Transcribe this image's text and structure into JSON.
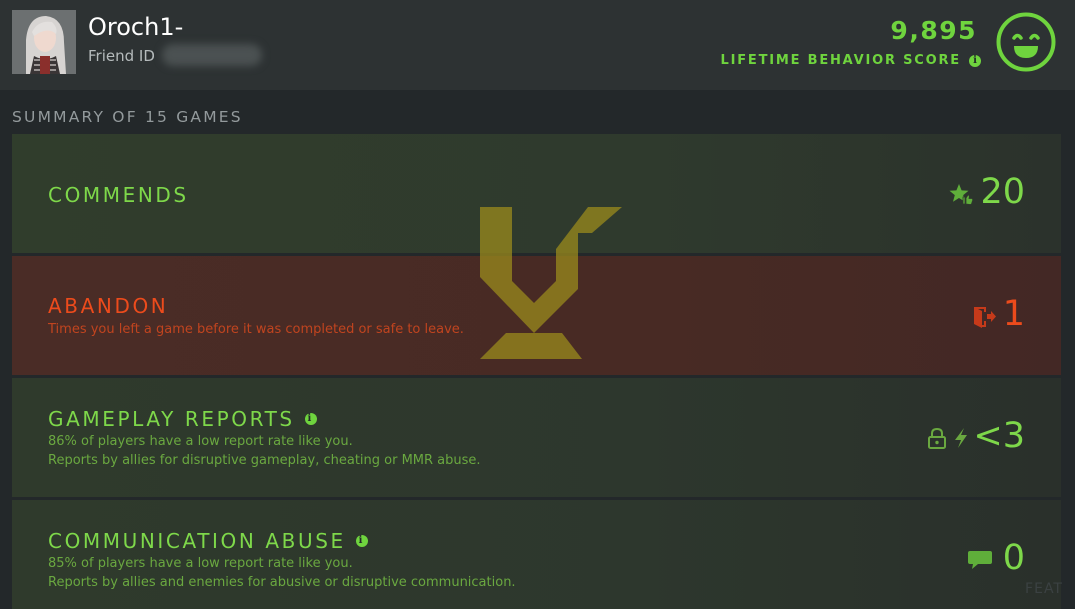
{
  "header": {
    "player_name": "Oroch1-",
    "friend_id_label": "Friend ID",
    "friend_id_value": "",
    "behavior_score": "9,895",
    "behavior_label": "LIFETIME BEHAVIOR SCORE",
    "info_glyph": "i",
    "face_icon": "smiley-face-icon"
  },
  "summary": {
    "title": "SUMMARY OF 15 GAMES"
  },
  "rows": {
    "commends": {
      "title": "COMMENDS",
      "value": "20",
      "icon": "star-thumbs-up-icon"
    },
    "abandon": {
      "title": "ABANDON",
      "description": "Times you left a game before it was completed or safe to leave.",
      "value": "1",
      "icon": "exit-door-icon"
    },
    "gameplay_reports": {
      "title": "GAMEPLAY REPORTS",
      "description_1": "86% of players have a low report rate like you.",
      "description_2": "Reports by allies for disruptive gameplay, cheating or MMR abuse.",
      "value": "<3",
      "icons": [
        "lock-icon",
        "lightning-icon"
      ]
    },
    "communication_abuse": {
      "title": "COMMUNICATION ABUSE",
      "description_1": "85% of players have a low report rate like you.",
      "description_2": "Reports by allies and enemies for abusive or disruptive communication.",
      "value": "0",
      "icon": "chat-bubble-icon"
    }
  },
  "corner_text": "FEAT",
  "colors": {
    "green": "#7ed84a",
    "red": "#ec4b1c",
    "background": "#23282a"
  }
}
